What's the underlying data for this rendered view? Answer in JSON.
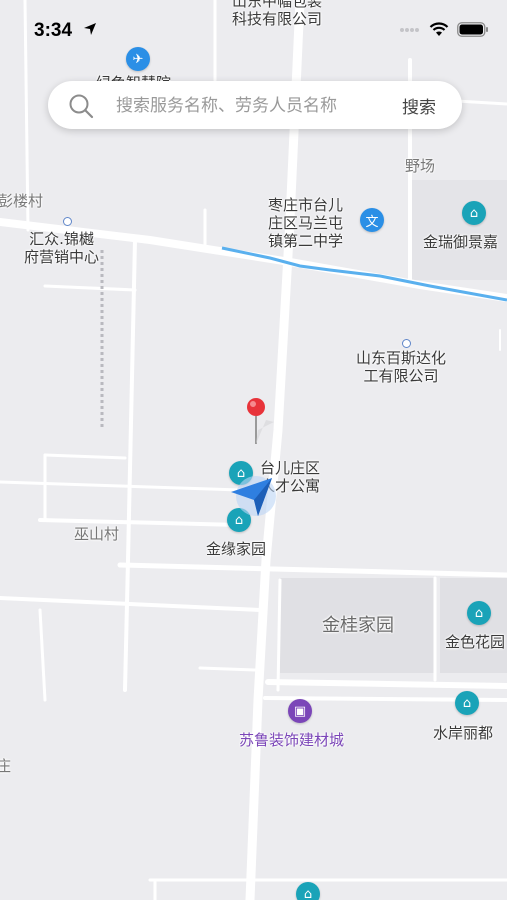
{
  "status_bar": {
    "time": "3:34",
    "location_icon": "location-arrow-icon",
    "signal_icon": "signal-dots-icon",
    "wifi_icon": "wifi-icon",
    "battery_icon": "battery-icon"
  },
  "search": {
    "placeholder": "搜索服务名称、劳务人员名称",
    "value": "",
    "button_label": "搜索",
    "icon": "search-icon"
  },
  "map": {
    "labels": {
      "top_company_line1": "山东中幅包装",
      "top_company_line2": "科技有限公司",
      "top_poi_cut": "绿色智慧院",
      "yechang": "野场",
      "pengloucun": "彭楼村",
      "huizhong_line1": "汇众.锦樾",
      "huizhong_line2": "府营销中心",
      "school_line1": "枣庄市台儿",
      "school_line2": "庄区马兰屯",
      "school_line3": "镇第二中学",
      "jinrui": "金瑞御景嘉",
      "baisida_line1": "山东百斯达化",
      "baisida_line2": "工有限公司",
      "talent_line1": "台儿庄区",
      "talent_line2": "人才公寓",
      "wushancun": "巫山村",
      "jinyuan": "金缘家园",
      "jingui": "金桂家园",
      "jinse": "金色花园",
      "shuian": "水岸丽都",
      "sulu": "苏鲁装饰建材城",
      "zhuang": "庄"
    },
    "colors": {
      "background": "#ececef",
      "road": "#ffffff",
      "river": "#5ab0ee",
      "poi_teal": "#1aa3b8",
      "poi_blue": "#2b8fe6",
      "poi_purple": "#7b46b8",
      "pin_red": "#e8333a",
      "arrow_blue": "#2f7fe0"
    }
  }
}
